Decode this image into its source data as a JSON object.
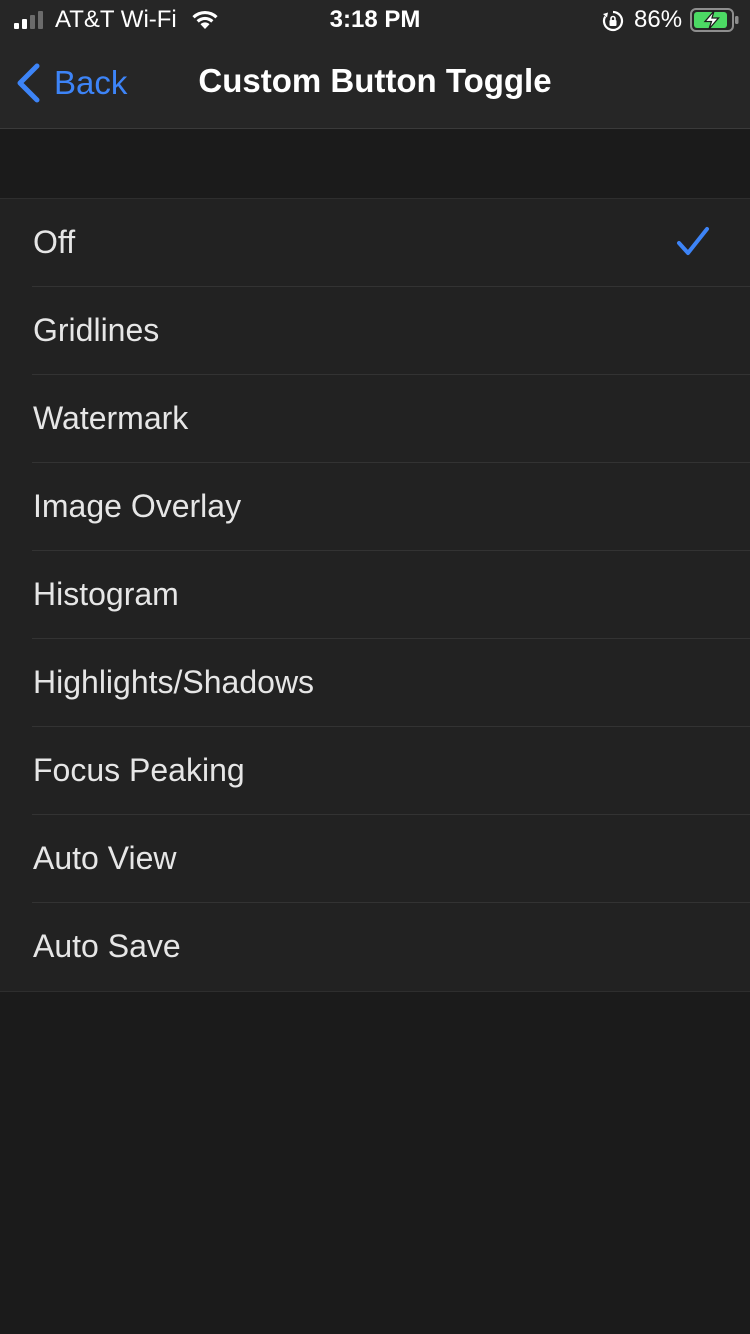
{
  "status_bar": {
    "carrier": "AT&T Wi-Fi",
    "time": "3:18 PM",
    "battery_percent": "86%"
  },
  "nav": {
    "back_label": "Back",
    "title": "Custom Button Toggle"
  },
  "options": [
    {
      "label": "Off",
      "selected": true
    },
    {
      "label": "Gridlines",
      "selected": false
    },
    {
      "label": "Watermark",
      "selected": false
    },
    {
      "label": "Image Overlay",
      "selected": false
    },
    {
      "label": "Histogram",
      "selected": false
    },
    {
      "label": "Highlights/Shadows",
      "selected": false
    },
    {
      "label": "Focus Peaking",
      "selected": false
    },
    {
      "label": "Auto View",
      "selected": false
    },
    {
      "label": "Auto Save",
      "selected": false
    }
  ],
  "colors": {
    "accent": "#3d84f7",
    "background": "#1b1b1b",
    "row_background": "#222222",
    "battery_fill": "#4cd964"
  },
  "icons": {
    "signal": "cellular-signal-icon",
    "wifi": "wifi-icon",
    "orientation_lock": "orientation-lock-icon",
    "battery": "battery-charging-icon",
    "back": "chevron-left-icon",
    "selected": "checkmark-icon"
  }
}
